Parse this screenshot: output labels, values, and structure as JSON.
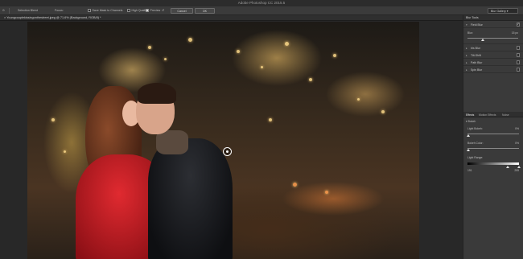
{
  "app": {
    "title": "Adobe Photoshop CC 2015.5"
  },
  "options_bar": {
    "select_focus_area": "Selection Bleed",
    "focus_label": "Focus:",
    "save_mask_label": "Save Mask to Channels",
    "high_quality_label": "High Quality",
    "preview_label": "Preview",
    "cancel_label": "Cancel",
    "ok_label": "OK",
    "workspace": "Blur Gallery"
  },
  "document": {
    "tab_label": "Youngcouplekissingonthestreet.jpeg @ 71.6% (Background, RGB/8) *"
  },
  "blur_tools": {
    "header": "Blur Tools",
    "items": [
      {
        "label": "Field Blur",
        "checked": true,
        "expanded": true
      },
      {
        "label": "Iris Blur",
        "checked": false
      },
      {
        "label": "Tilt-Shift",
        "checked": false
      },
      {
        "label": "Path Blur",
        "checked": false
      },
      {
        "label": "Spin Blur",
        "checked": false
      }
    ],
    "field_blur": {
      "blur_label": "Blur:",
      "blur_value": "15 px",
      "blur_level": 0.3
    }
  },
  "effects_panel": {
    "tabs": [
      "Effects",
      "Motion Effects",
      "Noise"
    ],
    "bokeh_label": "Bokeh",
    "light_bokeh_label": "Light Bokeh:",
    "light_bokeh_value": "0%",
    "bokeh_color_label": "Bokeh Color:",
    "bokeh_color_value": "0%",
    "light_range_label": "Light Range:",
    "light_range_min": "191",
    "light_range_max": "255"
  }
}
